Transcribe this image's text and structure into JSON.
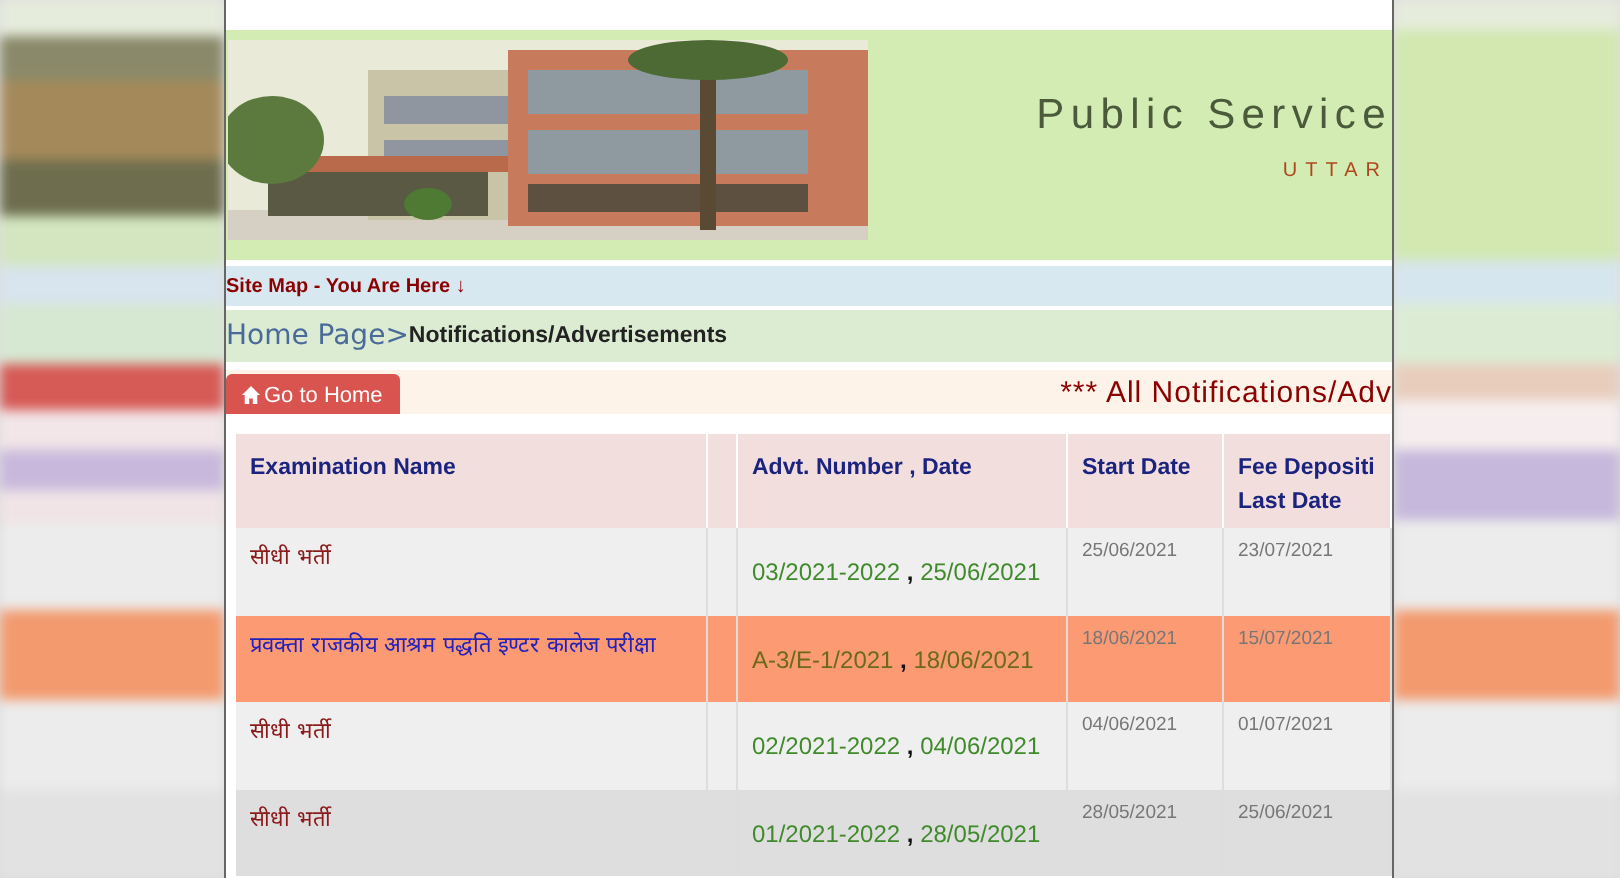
{
  "header": {
    "title": "Public Service",
    "subtitle": "UTTAR"
  },
  "sitemap": "Site Map - You Are Here ↓",
  "breadcrumb": {
    "home": "Home Page",
    "separator": ">",
    "current": "Notifications/Advertisements"
  },
  "home_button": {
    "label": "Go to Home"
  },
  "notice_heading": "*** All Notifications/Adv",
  "table": {
    "columns": [
      "Examination Name",
      "Advt. Number , Date",
      "Start Date",
      "Fee Depositi\nLast Date"
    ],
    "rows": [
      {
        "kind": "plain",
        "name": "सीधी भर्ती",
        "advt": "03/2021-2022 **,** 25/06/2021",
        "start_date": "25/06/2021",
        "last_date": "23/07/2021"
      },
      {
        "kind": "new",
        "name": "प्रवक्ता राजकीय आश्रम पद्धति इण्टर कालेज परीक्षा",
        "advt": "A-3/E-1/2021 **,** 18/06/2021",
        "start_date": "18/06/2021",
        "last_date": "15/07/2021"
      },
      {
        "kind": "plain",
        "name": "सीधी भर्ती",
        "advt": "02/2021-2022 **,** 04/06/2021",
        "start_date": "04/06/2021",
        "last_date": "01/07/2021"
      },
      {
        "kind": "hover",
        "name": "सीधी भर्ती",
        "advt": "01/2021-2022 **,** 28/05/2021",
        "start_date": "28/05/2021",
        "last_date": "25/06/2021"
      }
    ]
  }
}
